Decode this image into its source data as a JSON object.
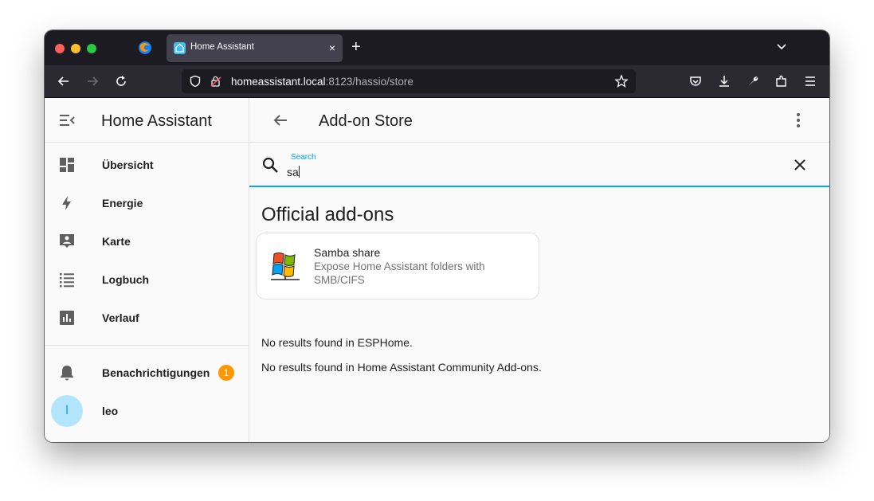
{
  "browser": {
    "tab_title": "Home Assistant",
    "tab_close": "×",
    "new_tab": "+",
    "url_host": "homeassistant.local",
    "url_path": ":8123/hassio/store"
  },
  "sidebar": {
    "title": "Home Assistant",
    "items": [
      {
        "label": "Übersicht",
        "icon": "dashboard-icon"
      },
      {
        "label": "Energie",
        "icon": "lightning-icon"
      },
      {
        "label": "Karte",
        "icon": "map-account-icon"
      },
      {
        "label": "Logbuch",
        "icon": "list-icon"
      },
      {
        "label": "Verlauf",
        "icon": "chart-box-icon"
      }
    ],
    "notifications": {
      "label": "Benachrichtigungen",
      "count": "1"
    },
    "user": {
      "initial": "l",
      "name": "leo"
    }
  },
  "main": {
    "title": "Add-on Store",
    "search": {
      "label": "Search",
      "value": "sa"
    },
    "section_title": "Official add-ons",
    "addon": {
      "title": "Samba share",
      "description": "Expose Home Assistant folders with SMB/CIFS"
    },
    "messages": [
      "No results found in ESPHome.",
      "No results found in Home Assistant Community Add-ons."
    ]
  },
  "colors": {
    "accent": "#03a9f4",
    "badge": "#ff9800",
    "avatar_bg": "#b3e5fc"
  }
}
